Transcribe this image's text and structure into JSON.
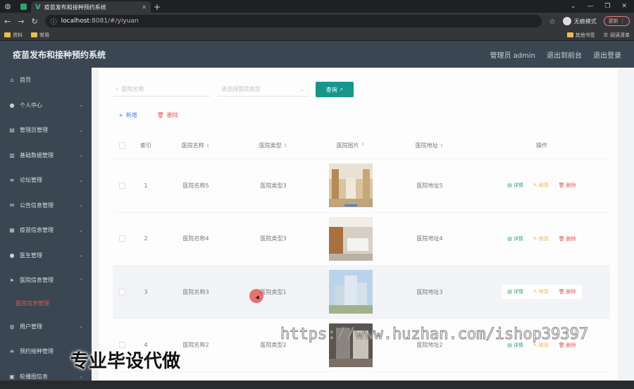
{
  "browser": {
    "tab_title": "疫苗发布和接种预约系统",
    "url_host": "localhost",
    "url_rest": ":8081/#/yiyuan",
    "incognito_label": "无痕模式",
    "update_label": "更新",
    "bookmarks_left": [
      "资料",
      "常用"
    ],
    "bookmarks_right": [
      "其他书签",
      "阅读清单"
    ]
  },
  "header": {
    "title": "疫苗发布和接种预约系统",
    "admin_label": "管理员 admin",
    "front_link": "退出到前台",
    "logout_link": "退出登录"
  },
  "sidebar": {
    "items": [
      {
        "label": "首页",
        "icon": "home-icon"
      },
      {
        "label": "个人中心",
        "icon": "user-icon"
      },
      {
        "label": "管理员管理",
        "icon": "admin-icon"
      },
      {
        "label": "基础数据管理",
        "icon": "data-icon"
      },
      {
        "label": "论坛管理",
        "icon": "list-icon"
      },
      {
        "label": "公告信息管理",
        "icon": "mail-icon"
      },
      {
        "label": "疫苗信息管理",
        "icon": "grid-icon"
      },
      {
        "label": "医生管理",
        "icon": "user-icon"
      },
      {
        "label": "医院信息管理",
        "icon": "send-icon"
      }
    ],
    "sub_active": "医院信息管理",
    "items_after": [
      {
        "label": "用户管理",
        "icon": "globe-icon"
      },
      {
        "label": "预约接种管理",
        "icon": "list-icon"
      },
      {
        "label": "轮播图信息",
        "icon": "image-icon"
      }
    ]
  },
  "search": {
    "name_placeholder": "医院名称",
    "type_placeholder": "请选择医院类型",
    "query_label": "查询"
  },
  "actions": {
    "add_label": "新增",
    "delete_label": "删除"
  },
  "table": {
    "headers": {
      "index": "索引",
      "name": "医院名称",
      "type": "医院类型",
      "image": "医院图片",
      "address": "医院地址",
      "ops": "操作"
    },
    "op_labels": {
      "detail": "详情",
      "edit": "修改",
      "delete": "删除"
    },
    "rows": [
      {
        "index": "1",
        "name": "医院名称5",
        "type": "医院类型3",
        "address": "医院地址5"
      },
      {
        "index": "2",
        "name": "医院名称4",
        "type": "医院类型3",
        "address": "医院地址4"
      },
      {
        "index": "3",
        "name": "医院名称3",
        "type": "医院类型1",
        "address": "医院地址3"
      },
      {
        "index": "4",
        "name": "医院名称2",
        "type": "医院类型2",
        "address": "医院地址2"
      }
    ]
  },
  "watermark": {
    "url_text": "https://www.huzhan.com/ishop39397",
    "cn_text": "专业毕设代做"
  },
  "colors": {
    "sidebar_bg": "#3a4652",
    "accent_teal": "#18968c",
    "active_menu": "#e0554d",
    "link_blue": "#4a7fe0",
    "danger": "#e35a5a"
  }
}
